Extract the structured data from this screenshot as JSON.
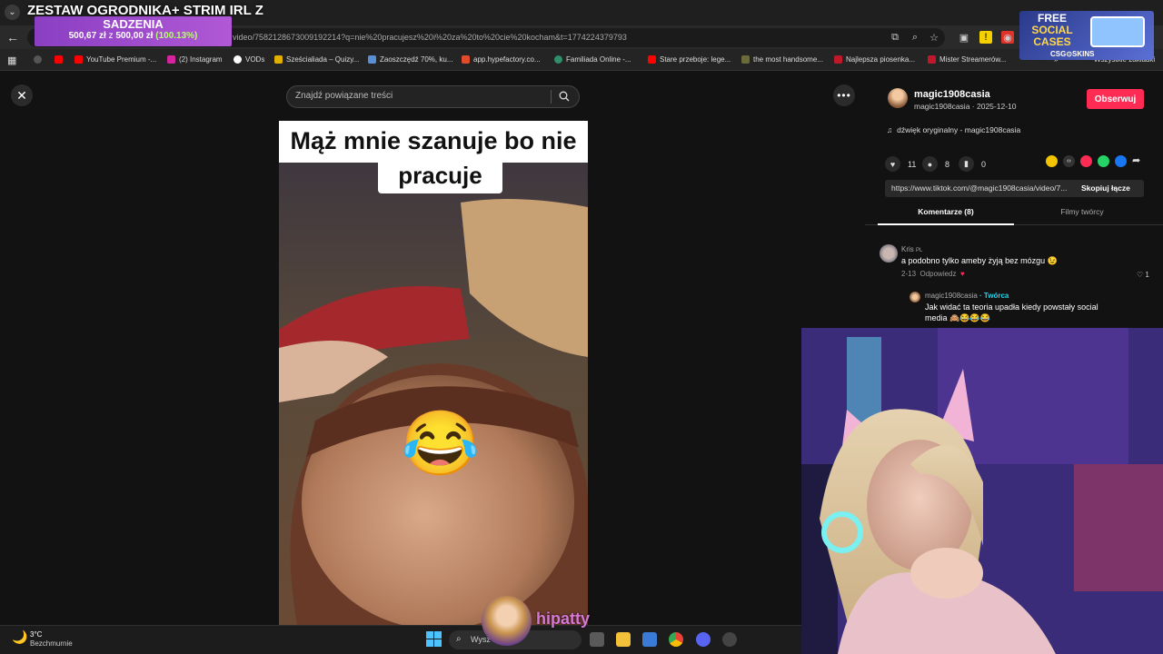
{
  "overlay": {
    "stream_title": "ZESTAW OGRODNIKA+ STRIM IRL Z",
    "donation_title": "SADZENIA",
    "donation_raised": "500,67 zł",
    "donation_sep": "z",
    "donation_goal": "500,00 zł",
    "donation_pct": "(100.13%)",
    "streamer_name": "hipatty"
  },
  "browser": {
    "url": "video/7582128673009192214?q=nie%20pracujesz%20i%20za%20to%20cie%20kocham&t=1774224379793",
    "bookmarks": [
      "YouTube Premium -...",
      "(2) Instagram",
      "VODs",
      "Sześcialiada – Quizy...",
      "Zaoszczędź 70%, ku...",
      "app.hypefactory.co...",
      "Familiada Online -...",
      "Stare przeboje: lege...",
      "the most handsome...",
      "Najlepsza piosenka...",
      "Mister Streamerów...",
      "Wszystkie zakładki"
    ],
    "ad": {
      "line1": "FREE",
      "line2": "SOCIAL",
      "line3": "CASES",
      "brand": "CSG⊙SKINS"
    }
  },
  "search": {
    "placeholder": "Znajdź powiązane treści"
  },
  "video": {
    "caption_line1": "Mąż mnie szanuje bo nie",
    "caption_line2": "pracuje",
    "emoji": "😂"
  },
  "post": {
    "author": "magic1908casia",
    "author_handle": "magic1908casia",
    "date": "2025-12-10",
    "follow_label": "Obserwuj",
    "sound": "dźwięk oryginalny - magic1908casia",
    "likes": "11",
    "comments_count": "8",
    "saves": "0",
    "link": "https://www.tiktok.com/@magic1908casia/video/7...",
    "copy_label": "Skopiuj łącze",
    "tab_comments": "Komentarze (8)",
    "tab_videos": "Filmy twórcy"
  },
  "comments": [
    {
      "author": "Kris",
      "flag": "PL",
      "text": "a podobno tylko ameby żyją bez mózgu 😉",
      "date": "2-13",
      "reply_label": "Odpowiedz",
      "likes": "1"
    },
    {
      "author": "magic1908casia",
      "badge": "· Twórca",
      "text": "Jak widać ta teoria upadła kiedy powstały social",
      "text2": "media 🙈😂😂😂"
    }
  ],
  "taskbar": {
    "temp": "3°C",
    "weather": "Bezchmurnie",
    "search_placeholder": "Wysz"
  },
  "colors": {
    "follow": "#fe2c55",
    "donation": "#a24fcf",
    "creator_badge": "#20d5ec"
  }
}
